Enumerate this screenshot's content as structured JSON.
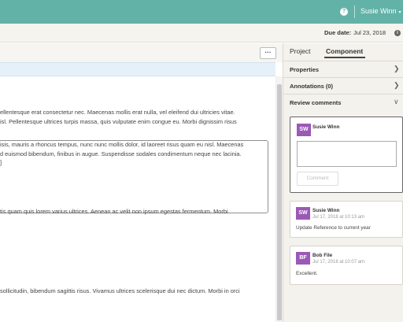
{
  "header": {
    "help_icon": "?",
    "user_name": "Susie Winn",
    "caret": "▾"
  },
  "subheader": {
    "due_label": "Due date:",
    "due_value": "Jul 23, 2018",
    "info_icon": "i"
  },
  "toolbar": {
    "more_label": "···"
  },
  "document": {
    "lines": [
      "ellentesque erat consectetur nec. Maecenas mollis erat nulla, vel eleifend dui ultricies vitae.",
      "isl. Pellentesque ultrices turpis massa, quis vulputate enim congue eu. Morbi dignissim risus",
      "isis, mauris a rhoncus tempus, nunc nunc mollis dolor, id laoreet risus quam eu nisl. Maecenas",
      "d euismod bibendum, finibus in augue. Suspendisse sodales condimentum neque nec lacinia.",
      "]",
      "tis quam quis lorem varius ultrices. Aenean ac velit non ipsum egestas fermentum. Morbi",
      "sollicitudin, bibendum sagittis risus. Vivamus ultrices scelerisque dui nec dictum. Morbi in orci"
    ]
  },
  "panel": {
    "tabs": [
      {
        "label": "Project"
      },
      {
        "label": "Component"
      }
    ],
    "sections": [
      {
        "label": "Properties",
        "chevron": "❯"
      },
      {
        "label": "Annotations (0)",
        "chevron": "❯"
      },
      {
        "label": "Review comments",
        "chevron": "∨"
      }
    ],
    "new_comment": {
      "initials": "SW",
      "author": "Susie Winn",
      "button_label": "Comment"
    },
    "comments": [
      {
        "initials": "SW",
        "author": "Susie Winn",
        "time": "Jul 17, 2018 at 10:13 am",
        "body": "Update Reference to current year"
      },
      {
        "initials": "BF",
        "author": "Bob File",
        "time": "Jul 17, 2018 at 10:07 am",
        "body": "Excellent."
      }
    ]
  },
  "colors": {
    "header_bg": "#63b2a7",
    "avatar_purple": "#9b59b6"
  }
}
